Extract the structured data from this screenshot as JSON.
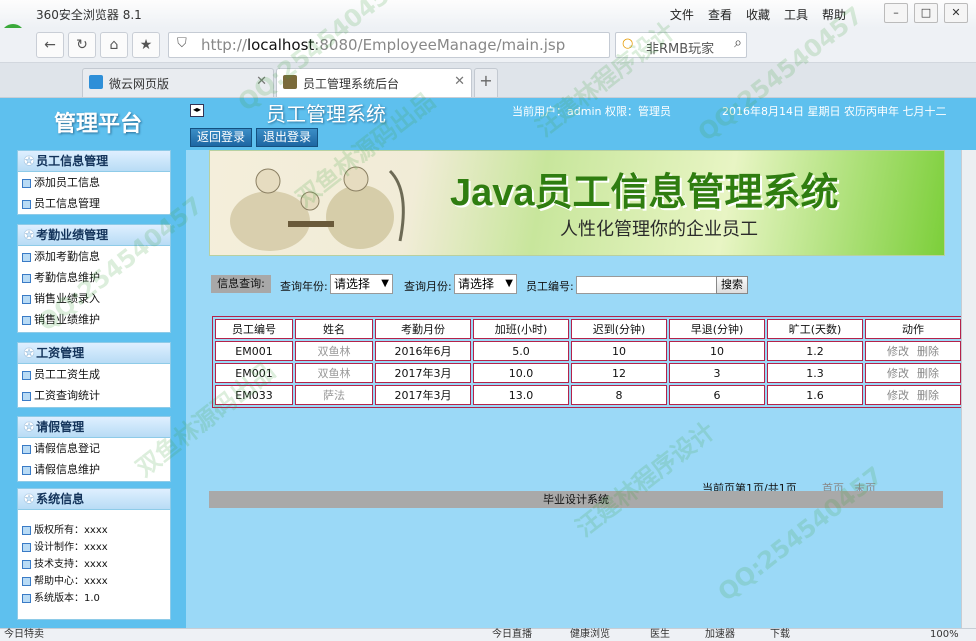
{
  "browser": {
    "app_title": "360安全浏览器 8.1",
    "menu": [
      "文件",
      "查看",
      "收藏",
      "工具",
      "帮助"
    ],
    "url_host": "localhost",
    "url_rest": ":8080/EmployeeManage/main.jsp",
    "url_prefix": "http://",
    "search_text": "非RMB玩家",
    "tabs": [
      {
        "label": "微云网页版",
        "active": false
      },
      {
        "label": "员工管理系统后台",
        "active": true
      }
    ]
  },
  "header": {
    "logo": "管理平台",
    "system_title": "员工管理系统",
    "user_info": "当前用户：admin 权限：管理员",
    "date_info": "2016年8月14日 星期日 农历丙申年 七月十二",
    "back_login": "返回登录",
    "logout": "退出登录"
  },
  "sidebar": {
    "panels": [
      {
        "title": "员工信息管理",
        "items": [
          "添加员工信息",
          "员工信息管理"
        ]
      },
      {
        "title": "考勤业绩管理",
        "items": [
          "添加考勤信息",
          "考勤信息维护",
          "销售业绩录入",
          "销售业绩维护"
        ]
      },
      {
        "title": "工资管理",
        "items": [
          "员工工资生成",
          "工资查询统计"
        ]
      },
      {
        "title": "请假管理",
        "items": [
          "请假信息登记",
          "请假信息维护"
        ]
      }
    ],
    "info_panel": {
      "title": "系统信息",
      "rows": [
        "版权所有：xxxx",
        "设计制作：xxxx",
        "技术支持：xxxx",
        "帮助中心：xxxx",
        "系统版本：1.0"
      ]
    }
  },
  "banner": {
    "title": "Java员工信息管理系统",
    "subtitle": "人性化管理你的企业员工"
  },
  "query": {
    "label": "信息查询:",
    "year_label": "查询年份:",
    "year_value": "请选择",
    "month_label": "查询月份:",
    "month_value": "请选择",
    "emp_label": "员工编号:",
    "emp_value": "",
    "search_button": "搜索"
  },
  "table": {
    "columns": [
      "员工编号",
      "姓名",
      "考勤月份",
      "加班(小时)",
      "迟到(分钟)",
      "早退(分钟)",
      "旷工(天数)",
      "动作"
    ],
    "rows": [
      {
        "id": "EM001",
        "name": "双鱼林",
        "month": "2016年6月",
        "overtime": "5.0",
        "late": "10",
        "early": "10",
        "absent": "1.2",
        "edit": "修改",
        "delete": "删除"
      },
      {
        "id": "EM001",
        "name": "双鱼林",
        "month": "2017年3月",
        "overtime": "10.0",
        "late": "12",
        "early": "3",
        "absent": "1.3",
        "edit": "修改",
        "delete": "删除"
      },
      {
        "id": "EM033",
        "name": "萨法",
        "month": "2017年3月",
        "overtime": "13.0",
        "late": "8",
        "early": "6",
        "absent": "1.6",
        "edit": "修改",
        "delete": "删除"
      }
    ]
  },
  "pager": {
    "text": "当前页第1页/共1页",
    "first": "首页",
    "last": "末页"
  },
  "footer": "毕业设计系统",
  "statusbar": {
    "left": "今日特卖",
    "items": [
      "今日直播",
      "健康浏览",
      "医生",
      "加速器",
      "下载",
      "100%"
    ]
  },
  "watermark": {
    "lines": [
      "QQ:254540457",
      "双鱼林源码出品",
      "汪建林程序设计",
      "QQ:254540457",
      "双鱼林源码出品",
      "汪建林程序设计",
      "QQ:254540457",
      "QQ:254540457"
    ]
  },
  "colors": {
    "app_bg": "#5ec0ee",
    "main_bg": "#9bd9f7",
    "table_border": "#b5224a",
    "button_blue": "#1d66a3"
  }
}
